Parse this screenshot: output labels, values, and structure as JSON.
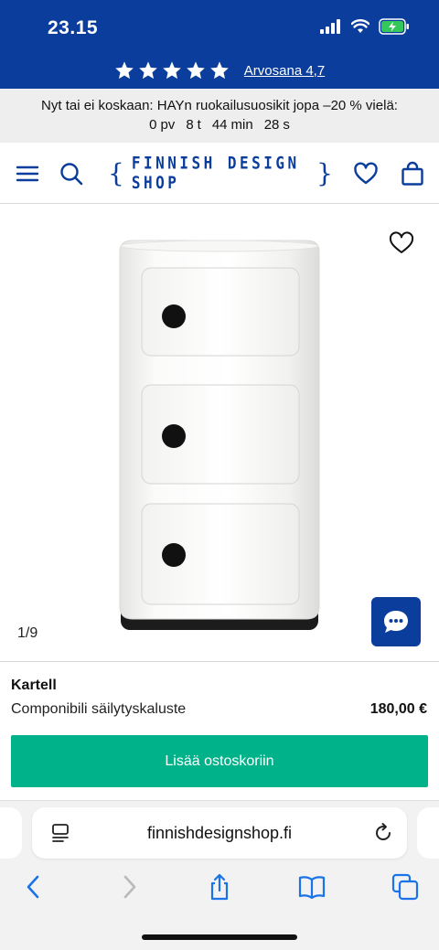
{
  "status_bar": {
    "time": "23.15"
  },
  "rating": {
    "stars": 5,
    "link_text": "Arvosana 4,7"
  },
  "promo": {
    "message": "Nyt tai ei koskaan: HAYn ruokailusuosikit jopa –20 % vielä:",
    "countdown": [
      {
        "value": "0",
        "unit": "pv"
      },
      {
        "value": "8",
        "unit": "t"
      },
      {
        "value": "44",
        "unit": "min"
      },
      {
        "value": "28",
        "unit": "s"
      }
    ]
  },
  "header": {
    "logo_text": "FINNISH DESIGN SHOP",
    "icons": [
      "menu-icon",
      "search-icon",
      "heart-icon",
      "bag-icon"
    ]
  },
  "gallery": {
    "pager": "1/9"
  },
  "product": {
    "brand": "Kartell",
    "name": "Componibili säilytyskaluste",
    "price": "180,00 €",
    "cart_button": "Lisää ostoskoriin"
  },
  "browser": {
    "url": "finnishdesignshop.fi"
  },
  "colors": {
    "brand_blue": "#0a3d9c",
    "cta_green": "#00b28a"
  }
}
